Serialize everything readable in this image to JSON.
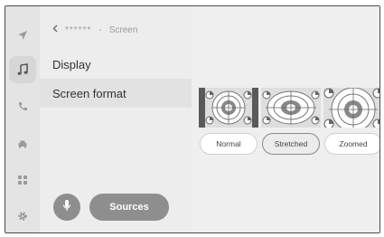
{
  "breadcrumb": {
    "parent": "******",
    "separator": "-",
    "current": "Screen"
  },
  "menu": [
    {
      "label": "Display"
    },
    {
      "label": "Screen format"
    }
  ],
  "formats": [
    {
      "label": "Normal"
    },
    {
      "label": "Stretched",
      "selected": true
    },
    {
      "label": "Zoomed"
    }
  ],
  "bottom": {
    "sources_label": "Sources"
  },
  "rail_icons": [
    "navigation-icon",
    "music-icon",
    "phone-icon",
    "car-icon",
    "apps-icon",
    "settings-icon"
  ]
}
